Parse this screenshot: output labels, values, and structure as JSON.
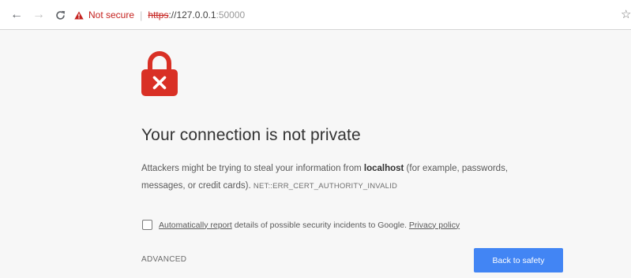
{
  "browser": {
    "back_icon": "arrow-left-icon",
    "forward_icon": "arrow-right-icon",
    "reload_icon": "reload-icon",
    "security_label": "Not secure",
    "url_scheme": "https",
    "url_separator": "://",
    "url_host": "127.0.0.1",
    "url_port": ":50000",
    "bookmark_icon": "star-icon"
  },
  "interstitial": {
    "icon": "broken-lock-icon",
    "heading": "Your connection is not private",
    "desc_before": "Attackers might be trying to steal your information from ",
    "desc_host": "localhost",
    "desc_after": " (for example, passwords, messages, or credit cards).",
    "error_code": "NET::ERR_CERT_AUTHORITY_INVALID",
    "report_link": "Automatically report",
    "report_text": " details of possible security incidents to Google.",
    "privacy_link": "Privacy policy",
    "report_checked": false,
    "advanced_label": "ADVANCED",
    "safety_button": "Back to safety"
  },
  "colors": {
    "danger": "#c5221f",
    "lock_red": "#d93025",
    "primary_button": "#4285f4",
    "page_bg": "#f7f7f7"
  }
}
